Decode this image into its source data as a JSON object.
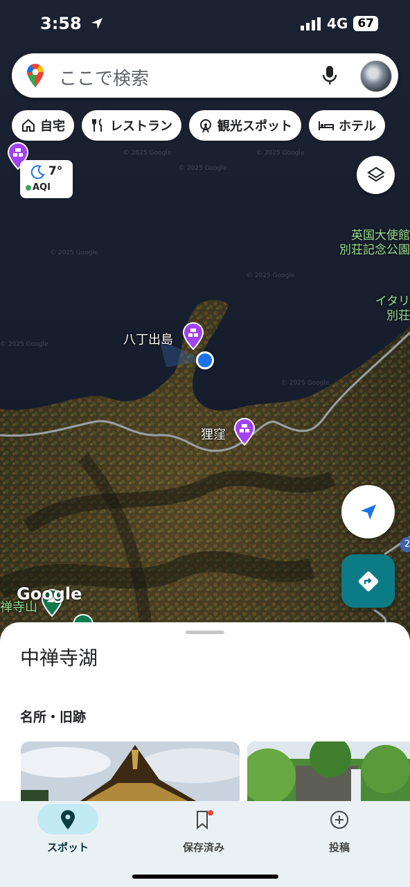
{
  "status_bar": {
    "time": "3:58",
    "network": "4G",
    "battery": "67"
  },
  "search": {
    "placeholder": "ここで検索"
  },
  "chips": [
    {
      "label": "自宅",
      "icon": "home-icon"
    },
    {
      "label": "レストラン",
      "icon": "restaurant-icon"
    },
    {
      "label": "観光スポット",
      "icon": "ferris-wheel-icon"
    },
    {
      "label": "ホテル",
      "icon": "bed-icon"
    }
  ],
  "weather": {
    "temp": "7°",
    "aqi": "AQI"
  },
  "map": {
    "labels": {
      "hacchodejima": "八丁出島",
      "tanukikubo": "狸窪",
      "british_embassy": "英国大使館\n別荘記念公園",
      "italy": "イタリ\n別荘",
      "chuzenji_mountain": "禅寺山"
    },
    "watermark": "© 2025 Google",
    "logo": "Google",
    "road_badge": "2"
  },
  "sheet": {
    "title": "中禅寺湖",
    "section": "名所・旧跡"
  },
  "bottom_nav": [
    {
      "label": "スポット",
      "icon": "location-pin-icon",
      "active": true
    },
    {
      "label": "保存済み",
      "icon": "bookmark-icon",
      "active": false
    },
    {
      "label": "投稿",
      "icon": "add-circle-icon",
      "active": false
    }
  ],
  "colors": {
    "accent": "#0b7b85",
    "active_pill": "#c2eaf2",
    "location_dot": "#1a73e8",
    "poi_purple": "#a142f4"
  }
}
